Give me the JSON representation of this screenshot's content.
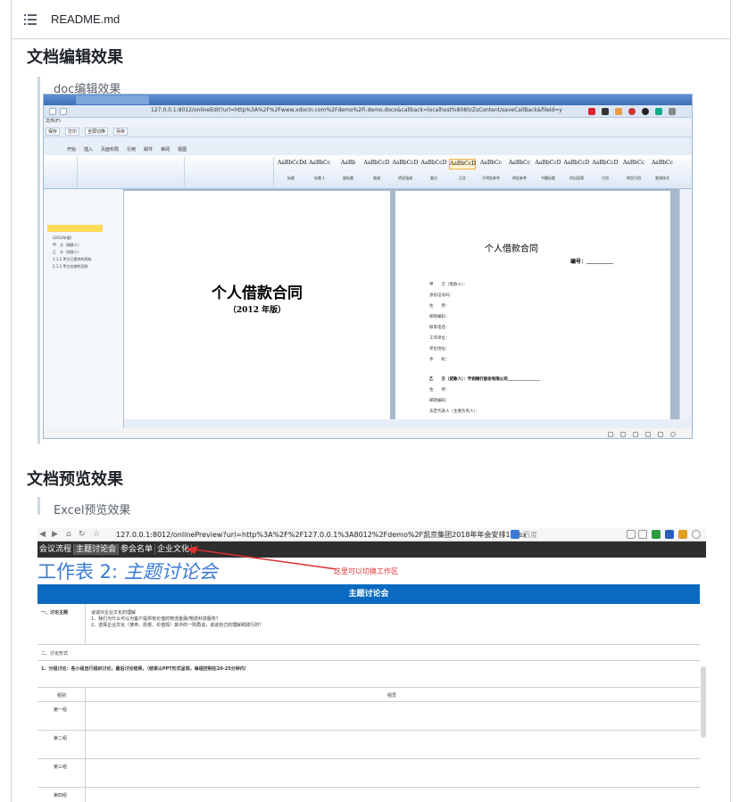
{
  "file": {
    "name": "README.md"
  },
  "sections": [
    {
      "heading": "文档编辑效果",
      "quote": "doc编辑效果"
    },
    {
      "heading": "文档预览效果",
      "quote": "Excel预览效果"
    }
  ],
  "word_shot": {
    "url": "127.0.0.1:8012/onlineEdit?url=http%3A%2F%2Fwww.xdocin.com%2Fdemo%2Fi.demo.docx&callback=localhost%8080/ZsContent/saveCallBack&fileId=y",
    "menu1": "文件(F)",
    "menu2": [
      "保存",
      "打印",
      "全屏切换",
      "另存"
    ],
    "ribbon_tabs": [
      "开始",
      "插入",
      "页面布局",
      "引用",
      "邮件",
      "审阅",
      "视图"
    ],
    "styles": [
      "AaBbCcDd",
      "AaBbCc",
      "AaBb",
      "AaBbCcD",
      "AaBbCcD",
      "AaBbCcD",
      "AaBbCcD",
      "AaBbCc",
      "AaBbCc",
      "AaBbCcD",
      "AaBbCcD",
      "AaBbCcD",
      "AaBbCc",
      "AaBbCc"
    ],
    "style_names": [
      "标题",
      "标题 1",
      "副标题",
      "强调",
      "明显强调",
      "要点",
      "正文",
      "不明显参考",
      "明显参考",
      "书籍标题",
      "列出段落",
      "引用",
      "明显引用",
      "更改样式"
    ],
    "nav_items": [
      "(2012年版)",
      "甲　方（借款人）",
      "乙　方（贷款人）",
      "1.1.1.甲方已提供的资料",
      "2.1.1.甲方应按时还款"
    ],
    "page1_title": "个人借款合同",
    "page1_subtitle": "（2012 年版）",
    "page2_title": "个人借款合同",
    "page2_number": "编号：＿＿＿＿＿",
    "page2_fields": [
      "甲　　方（借款人）：",
      "身份证号码：",
      "住　　所：",
      "邮政编码：",
      "联系电话：",
      "工作单位：",
      "单位地址：",
      "手　　机：",
      "乙　　方（贷款人）：宇润银行股份有限公司＿＿＿＿＿＿＿＿",
      "住　　所：",
      "邮政编码：",
      "法定代表人（主要负责人）："
    ]
  },
  "excel_shot": {
    "url": "127.0.0.1:8012/onlinePreview?url=http%3A%2F%2F127.0.0.1%3A8012%2Fdemo%2F凯京集团2018年年会安排1.xlsx",
    "search_placeholder": "百度",
    "sheet_tabs": [
      "会议流程",
      "主题讨论会",
      "参会名单",
      "企业文化"
    ],
    "sheet_heading_prefix": "工作表 2:",
    "sheet_heading_name": "主题讨论会",
    "annotation": "这里可以切换工作区",
    "table_title": "主题讨论会",
    "row1_label": "一、讨论主题",
    "row1_lines": [
      "谈谈对企业文化的理解",
      "1、我们为什么可以为客户提供有价值的物流金融/物流科技服务？",
      "2、选择企业文化（使命、愿景、价值观）其中的一则再谈，谈谈自己的理解和践行的？"
    ],
    "row2_label": "二、讨论形式",
    "row3_text": "1、分组讨论：各小组自行组织讨论，最后讨论结果，（结果以PPT形式呈现，每组控制在20-25分钟内）",
    "col_headers": [
      "组别",
      "组员"
    ],
    "groups": [
      "第一组",
      "第二组",
      "第三组",
      "第四组"
    ]
  }
}
